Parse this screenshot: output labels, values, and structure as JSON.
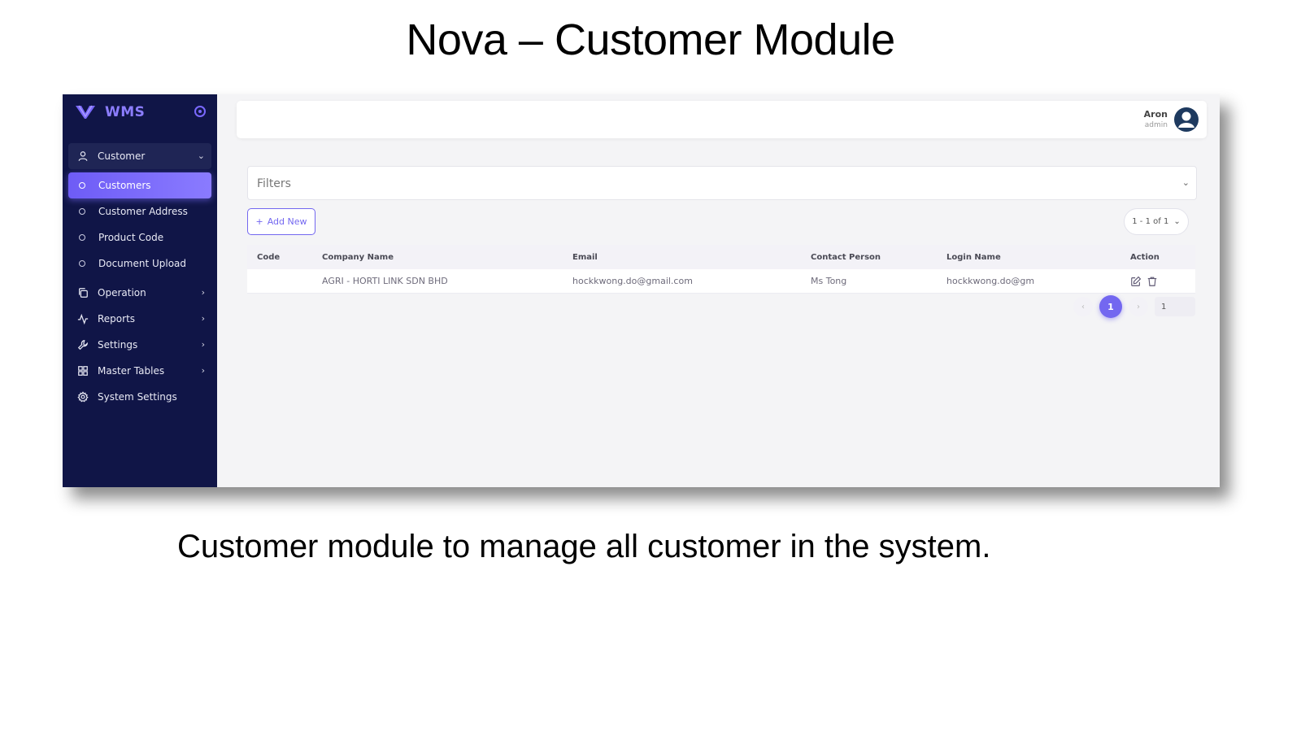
{
  "slide": {
    "title": "Nova – Customer Module",
    "caption": "Customer module to manage all customer in the system."
  },
  "app": {
    "brand": "WMS",
    "accent_color": "#7367f0",
    "sidebar_color": "#101547",
    "sidebar": {
      "group": {
        "label": "Customer",
        "icon": "user-icon"
      },
      "sub_items": [
        {
          "label": "Customers",
          "active": true
        },
        {
          "label": "Customer Address",
          "active": false
        },
        {
          "label": "Product Code",
          "active": false
        },
        {
          "label": "Document Upload",
          "active": false
        }
      ],
      "items": [
        {
          "label": "Operation",
          "icon": "copy-icon"
        },
        {
          "label": "Reports",
          "icon": "activity-icon"
        },
        {
          "label": "Settings",
          "icon": "tool-icon"
        },
        {
          "label": "Master Tables",
          "icon": "grid-icon"
        },
        {
          "label": "System Settings",
          "icon": "gear-icon"
        }
      ]
    },
    "user": {
      "name": "Aron",
      "role": "admin"
    },
    "filters_label": "Filters",
    "add_button": "Add New",
    "page_size": "1 - 1 of 1",
    "table": {
      "headers": [
        "Code",
        "Company Name",
        "Email",
        "Contact Person",
        "Login Name",
        "Action"
      ],
      "rows": [
        {
          "code": "",
          "company": "AGRI - HORTI LINK SDN BHD",
          "email": "hockkwong.do@gmail.com",
          "contact": "Ms Tong",
          "login": "hockkwong.do@gm"
        }
      ]
    },
    "pagination": {
      "current": "1",
      "goto": "1"
    }
  }
}
